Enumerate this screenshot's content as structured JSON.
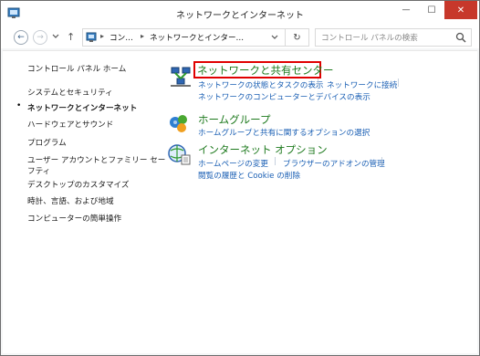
{
  "window": {
    "title": "ネットワークとインターネット",
    "minimize_glyph": "—",
    "maximize_glyph": "☐",
    "close_glyph": "✕",
    "accent_close": "#c7382b"
  },
  "addressbar": {
    "back_glyph": "←",
    "forward_glyph": "→",
    "up_glyph": "↑",
    "refresh_glyph": "↻",
    "breadcrumbs": [
      "コン…",
      "ネットワークとインター…"
    ],
    "separator": "▸"
  },
  "search": {
    "placeholder": "コントロール パネルの検索"
  },
  "sidebar": {
    "items": [
      {
        "label": "コントロール パネル ホーム"
      },
      {
        "label": "システムとセキュリティ"
      },
      {
        "label": "ネットワークとインターネット",
        "active": true
      },
      {
        "label": "ハードウェアとサウンド"
      },
      {
        "label": "プログラム"
      },
      {
        "label": "ユーザー アカウントとファミリー セー"
      },
      {
        "label": "フティ"
      },
      {
        "label": "デスクトップのカスタマイズ"
      },
      {
        "label": "時計、言語、および地域"
      },
      {
        "label": "コンピューターの簡単操作"
      }
    ],
    "bullet": "•"
  },
  "categories": [
    {
      "title": "ネットワークと共有センター",
      "icon": "network-sharing-icon",
      "links": [
        "ネットワークの状態とタスクの表示",
        "ネットワークに接続",
        "ネットワークのコンピューターとデバイスの表示"
      ]
    },
    {
      "title": "ホームグループ",
      "icon": "homegroup-icon",
      "links": [
        "ホームグループと共有に関するオプションの選択"
      ]
    },
    {
      "title": "インターネット オプション",
      "icon": "internet-options-icon",
      "links": [
        "ホームページの変更",
        "ブラウザーのアドオンの管理",
        "閲覧の履歴と Cookie の削除"
      ]
    }
  ],
  "link_separator": "|",
  "colors": {
    "category_title": "#1e7a1e",
    "link": "#1a5fb4",
    "highlight_box": "#e00000"
  }
}
